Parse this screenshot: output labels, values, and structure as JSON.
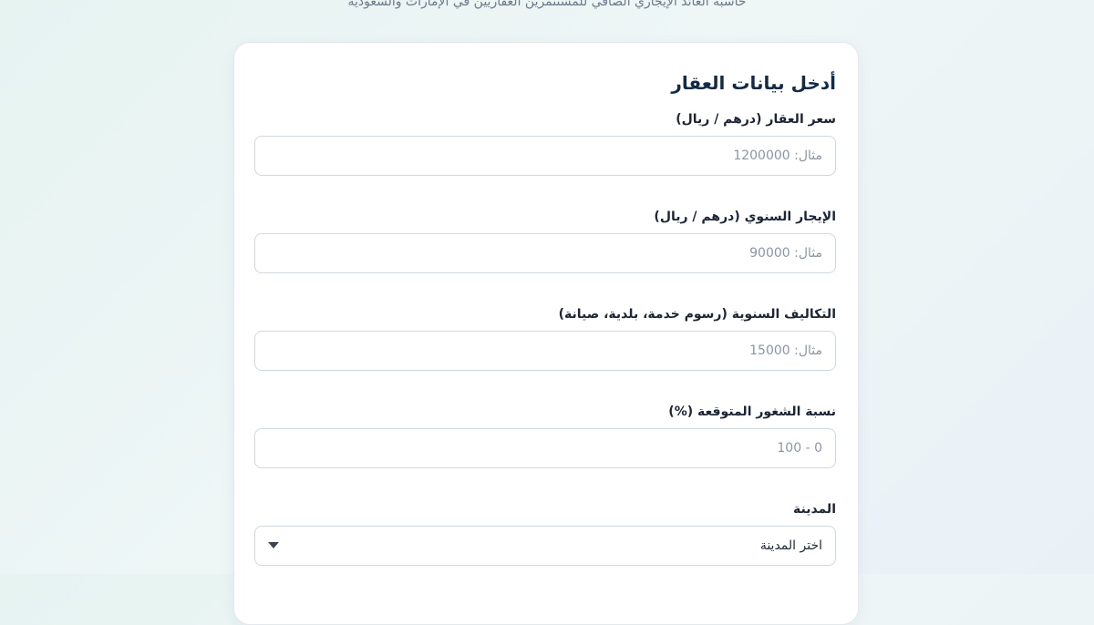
{
  "header": {
    "subtitle": "حاسبة العائد الإيجاري الصافي للمستثمرين العقاريين في الإمارات والسعودية"
  },
  "form": {
    "title": "أدخل بيانات العقار",
    "fields": [
      {
        "label": "سعر العقار (درهم / ريال)",
        "placeholder": "مثال: 1200000",
        "value": ""
      },
      {
        "label": "الإيجار السنوي (درهم / ريال)",
        "placeholder": "مثال: 90000",
        "value": ""
      },
      {
        "label": "التكاليف السنوية (رسوم خدمة، بلدية، صيانة)",
        "placeholder": "مثال: 15000",
        "value": ""
      },
      {
        "label": "نسبة الشغور المتوقعة (%)",
        "placeholder": "0 - 100",
        "value": ""
      }
    ],
    "city": {
      "label": "المدينة",
      "selected": "اختر المدينة",
      "icon": "chevron-down-icon"
    }
  }
}
